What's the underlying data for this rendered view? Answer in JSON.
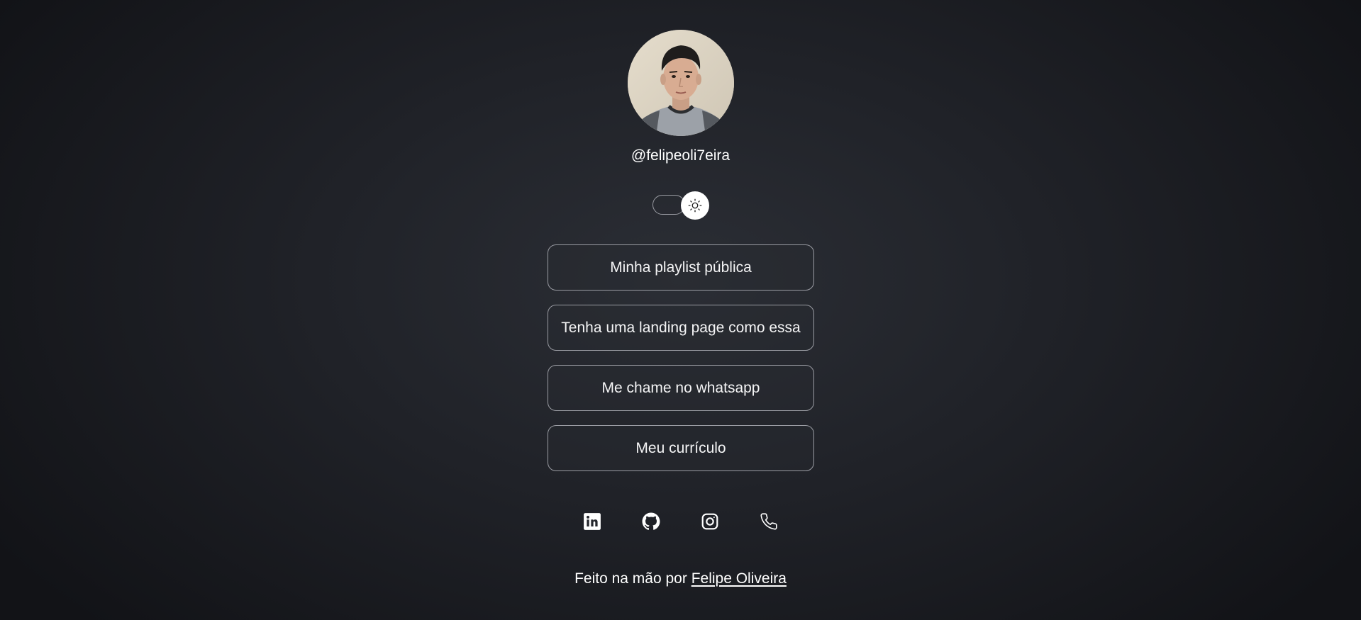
{
  "profile": {
    "username": "@felipeoli7eira",
    "avatar_icon": "profile-photo"
  },
  "theme_toggle": {
    "icon": "sun-icon",
    "state": "dark"
  },
  "links": [
    {
      "label": "Minha playlist pública"
    },
    {
      "label": "Tenha uma landing page como essa"
    },
    {
      "label": "Me chame no whatsapp"
    },
    {
      "label": "Meu currículo"
    }
  ],
  "socials": [
    {
      "icon": "linkedin-icon"
    },
    {
      "icon": "github-icon"
    },
    {
      "icon": "instagram-icon"
    },
    {
      "icon": "phone-icon"
    }
  ],
  "footer": {
    "prefix": "Feito na mão por ",
    "author": "Felipe Oliveira"
  },
  "colors": {
    "background": "#202228",
    "text": "#ffffff",
    "border": "#9a9ca3"
  }
}
